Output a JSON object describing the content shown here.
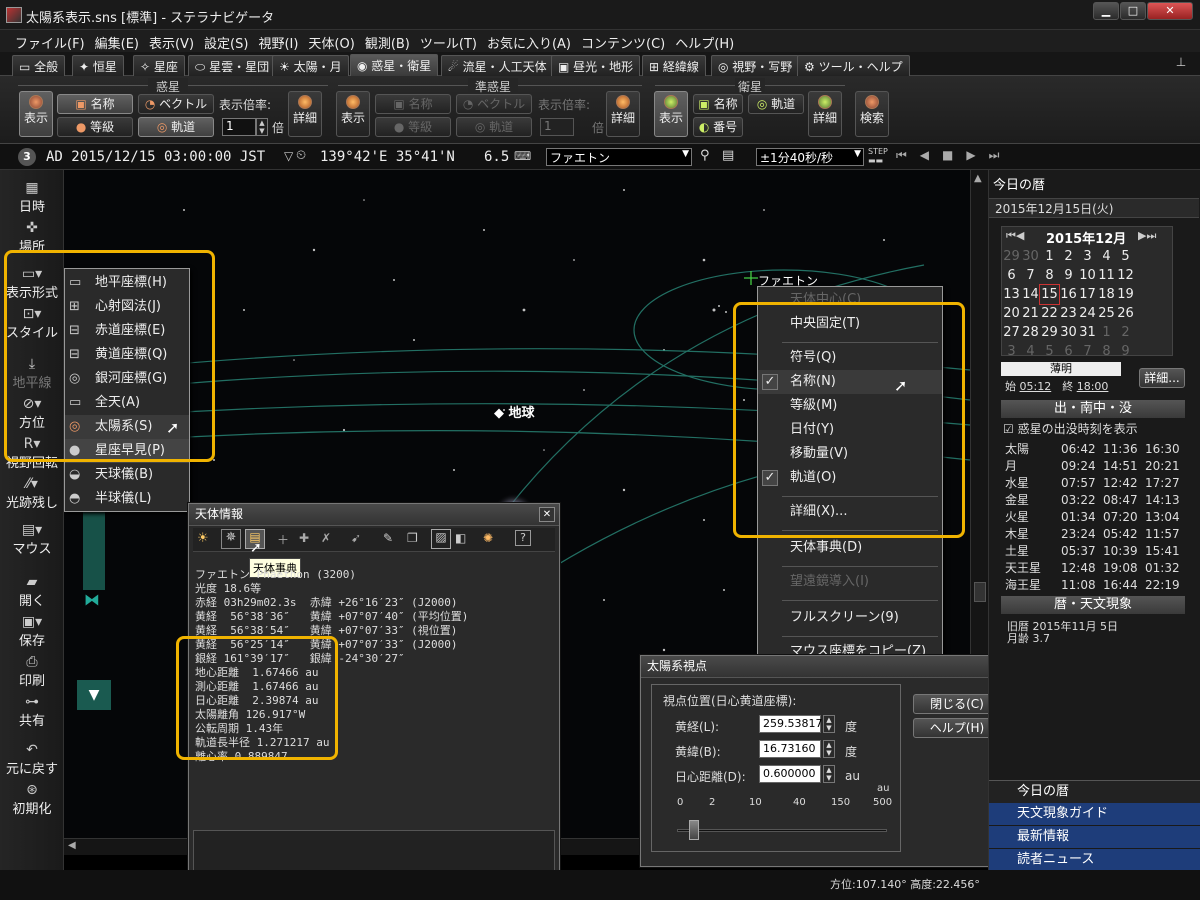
{
  "window": {
    "title": "太陽系表示.sns [標準] - ステラナビゲータ"
  },
  "menu": [
    "ファイル(F)",
    "編集(E)",
    "表示(V)",
    "設定(S)",
    "視野(I)",
    "天体(O)",
    "観測(B)",
    "ツール(T)",
    "お気に入り(A)",
    "コンテンツ(C)",
    "ヘルプ(H)"
  ],
  "tabs": [
    "全般",
    "恒星",
    "星座",
    "星雲・星団",
    "太陽・月",
    "惑星・衛星",
    "流星・人工天体",
    "昼光・地形",
    "経緯線",
    "視野・写野",
    "ツール・ヘルプ"
  ],
  "ribbon": {
    "planet_group": "惑星",
    "minor_group": "準惑星",
    "satellite_group": "衛星",
    "show": "表示",
    "name": "名称",
    "magnitude": "等級",
    "vector": "ベクトル",
    "orbit": "軌道",
    "scale_label": "表示倍率:",
    "scale_value": "1",
    "scale_unit": "倍",
    "detail": "詳細",
    "number": "番号",
    "search": "検索"
  },
  "status": {
    "date": "AD 2015/12/15 03:00:00 JST",
    "coords": "139°42'E 35°41'N",
    "magnitude": "6.5",
    "object": "ファエトン",
    "speed": "±1分40秒/秒"
  },
  "left_toolbar": [
    "日時",
    "場所",
    "表示形式",
    "スタイル",
    "地平線",
    "方位",
    "視野回転",
    "光跡残し",
    "マウス",
    "開く",
    "保存",
    "印刷",
    "共有",
    "元に戻す",
    "初期化"
  ],
  "view_menu": [
    "地平座標(H)",
    "心射図法(J)",
    "赤道座標(E)",
    "黄道座標(Q)",
    "銀河座標(G)",
    "全天(A)",
    "太陽系(S)",
    "星座早見(P)",
    "天球儀(B)",
    "半球儀(L)"
  ],
  "sky_labels": {
    "earth": "地球",
    "phaethon": "ファエトン"
  },
  "context_menu": [
    "天体中心(C)",
    "中央固定(T)",
    "符号(Q)",
    "名称(N)",
    "等級(M)",
    "日付(Y)",
    "移動量(V)",
    "軌道(O)",
    "詳細(X)...",
    "天体事典(D)",
    "望遠鏡導入(I)",
    "フルスクリーン(9)",
    "マウス座標をコピー(Z)"
  ],
  "info_window": {
    "title": "天体情報",
    "tooltip": "天体事典",
    "lines": [
      "ファエトン Phaethon (3200)",
      "光度 18.6等",
      "赤経 03h29m02.3s  赤緯 +26°16′23″ (J2000)",
      "黄経  56°38′36″   黄緯 +07°07′40″ (平均位置)",
      "黄経  56°38′54″   黄緯 +07°07′33″ (視位置)",
      "黄経  56°25′14″   黄緯 +07°07′33″ (J2000)",
      "銀経 161°39′17″   銀緯 -24°30′27″",
      "地心距離  1.67466 au",
      "測心距離  1.67466 au",
      "日心距離  2.39874 au",
      "太陽離角 126.917°W",
      "公転周期 1.43年",
      "軌道長半径 1.271217 au",
      "離心率 0.889847"
    ]
  },
  "solar_window": {
    "title": "太陽系視点",
    "section": "視点位置(日心黄道座標):",
    "lon_label": "黄経(L):",
    "lon_value": "259.53817",
    "lon_unit": "度",
    "lat_label": "黄緯(B):",
    "lat_value": "16.73160",
    "lat_unit": "度",
    "dist_label": "日心距離(D):",
    "dist_value": "0.600000",
    "dist_unit": "au",
    "scale_unit": "au",
    "scale": [
      "0",
      "2",
      "10",
      "40",
      "150",
      "500"
    ],
    "close": "閉じる(C)",
    "help": "ヘルプ(H)"
  },
  "right_panel": {
    "header": "今日の暦",
    "date": "2015年12月15日(火)",
    "month": "2015年12月",
    "calendar": [
      [
        "29",
        "30",
        "1",
        "2",
        "3",
        "4",
        "5"
      ],
      [
        "6",
        "7",
        "8",
        "9",
        "10",
        "11",
        "12"
      ],
      [
        "13",
        "14",
        "15",
        "16",
        "17",
        "18",
        "19"
      ],
      [
        "20",
        "21",
        "22",
        "23",
        "24",
        "25",
        "26"
      ],
      [
        "27",
        "28",
        "29",
        "30",
        "31",
        "1",
        "2"
      ],
      [
        "3",
        "4",
        "5",
        "6",
        "7",
        "8",
        "9"
      ]
    ],
    "twilight": "薄明",
    "tw_start_label": "始",
    "tw_start": "05:12",
    "tw_end_label": "終",
    "tw_end": "18:00",
    "detail": "詳細...",
    "rise_header": "出・南中・没",
    "checkbox_label": "惑星の出没時刻を表示",
    "planets": [
      [
        "太陽",
        "06:42",
        "11:36",
        "16:30"
      ],
      [
        "月",
        "09:24",
        "14:51",
        "20:21"
      ],
      [
        "水星",
        "07:57",
        "12:42",
        "17:27"
      ],
      [
        "金星",
        "03:22",
        "08:47",
        "14:13"
      ],
      [
        "火星",
        "01:34",
        "07:20",
        "13:04"
      ],
      [
        "木星",
        "23:24",
        "05:42",
        "11:57"
      ],
      [
        "土星",
        "05:37",
        "10:39",
        "15:41"
      ],
      [
        "天王星",
        "12:48",
        "19:08",
        "01:32"
      ],
      [
        "海王星",
        "11:08",
        "16:44",
        "22:19"
      ]
    ],
    "events_header": "暦・天文現象",
    "lunar": "旧暦 2015年11月 5日",
    "moon_age": "月齢 3.7",
    "bottom_tabs": [
      "今日の暦",
      "天文現象ガイド",
      "最新情報",
      "読者ニュース"
    ]
  },
  "bottom_status": "方位:107.140° 高度:22.456°"
}
